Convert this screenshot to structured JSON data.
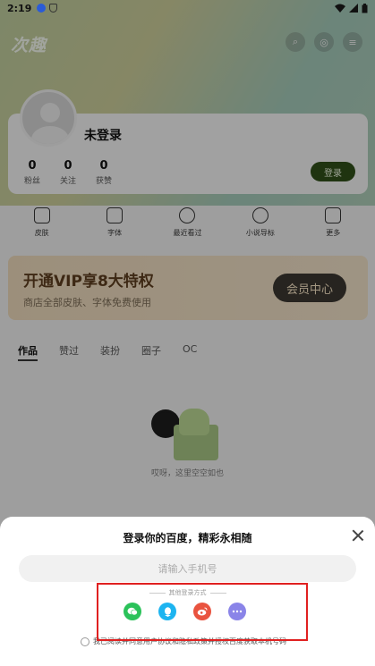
{
  "status_bar": {
    "time": "2:19"
  },
  "app": {
    "title": "次趣",
    "top_icons": [
      "search-icon",
      "camera-icon",
      "menu-icon"
    ],
    "profile": {
      "username": "未登录",
      "stats": [
        {
          "value": "0",
          "label": "粉丝"
        },
        {
          "value": "0",
          "label": "关注"
        },
        {
          "value": "0",
          "label": "获赞"
        }
      ],
      "login_label": "登录"
    },
    "quick_actions": [
      {
        "label": "皮肤",
        "icon": "tshirt-icon"
      },
      {
        "label": "字体",
        "icon": "font-icon"
      },
      {
        "label": "最近看过",
        "icon": "clock-icon"
      },
      {
        "label": "小说导标",
        "icon": "ai-avatar-icon"
      },
      {
        "label": "更多",
        "icon": "grid-icon"
      }
    ],
    "vip": {
      "title": "开通VIP享8大特权",
      "subtitle": "商店全部皮肤、字体免费使用",
      "button": "会员中心"
    },
    "tabs": [
      "作品",
      "赞过",
      "装扮",
      "圈子",
      "OC"
    ],
    "empty_text": "哎呀，这里空空如也"
  },
  "sheet": {
    "title": "登录你的百度，精彩永相随",
    "phone_placeholder": "请输入手机号",
    "other_methods_label": "其他登录方式",
    "methods": [
      "wechat-icon",
      "qq-icon",
      "weibo-icon",
      "more-icon"
    ],
    "agreement": "我已阅读并同意用户协议和隐私政策并授权百度获取本机号码"
  },
  "colors": {
    "login_button": "#2f4d18",
    "vip_button": "#3a3530",
    "wechat": "#2bc25a",
    "qq": "#1db4f0",
    "weibo": "#e9533f",
    "more": "#8a84e8",
    "highlight": "#e02020"
  }
}
